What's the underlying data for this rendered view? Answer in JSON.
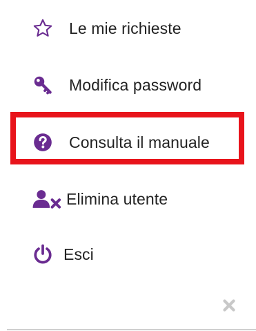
{
  "menu": {
    "items": [
      {
        "label": "Le mie richieste",
        "icon": "star-outline-icon"
      },
      {
        "label": "Modifica password",
        "icon": "key-icon"
      },
      {
        "label": "Consulta il manuale",
        "icon": "question-circle-icon"
      },
      {
        "label": "Elimina utente",
        "icon": "user-times-icon"
      },
      {
        "label": "Esci",
        "icon": "power-icon"
      }
    ],
    "close_icon": "close-icon"
  },
  "colors": {
    "icon_purple": "#6a2c91",
    "highlight_red": "#e8141b",
    "text": "#222222",
    "close_grey": "#c8c8c8",
    "divider": "#cfcfcf"
  }
}
